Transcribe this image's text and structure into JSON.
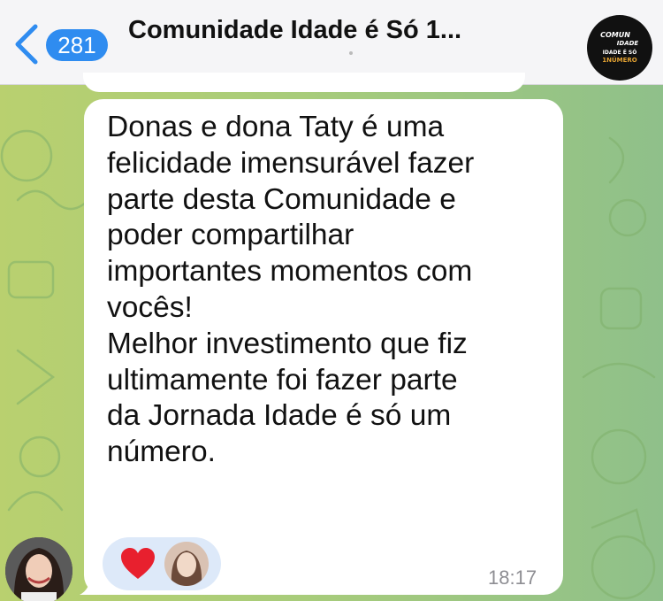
{
  "header": {
    "unread_count": "281",
    "chat_title": "Comunidade Idade é Só 1..."
  },
  "group_avatar": {
    "logo_text": [
      "COMUN",
      "IDADE",
      "IDADE É SÓ",
      "1NÚMERO"
    ],
    "icon": "group-logo"
  },
  "message": {
    "lines": [
      "Donas e dona Taty é uma",
      "felicidade imensurável fazer",
      "parte desta Comunidade e",
      "poder compartilhar",
      "importantes momentos com",
      "vocês!",
      "Melhor investimento que fiz",
      "ultimamente foi fazer parte",
      "da Jornada Idade é só um",
      "número."
    ],
    "time": "18:17",
    "reaction_icon": "red-heart-icon"
  },
  "colors": {
    "accent": "#2f8cf0",
    "bubble": "#ffffff",
    "heart": "#e8202e",
    "reaction_bg": "#dde9f9"
  }
}
